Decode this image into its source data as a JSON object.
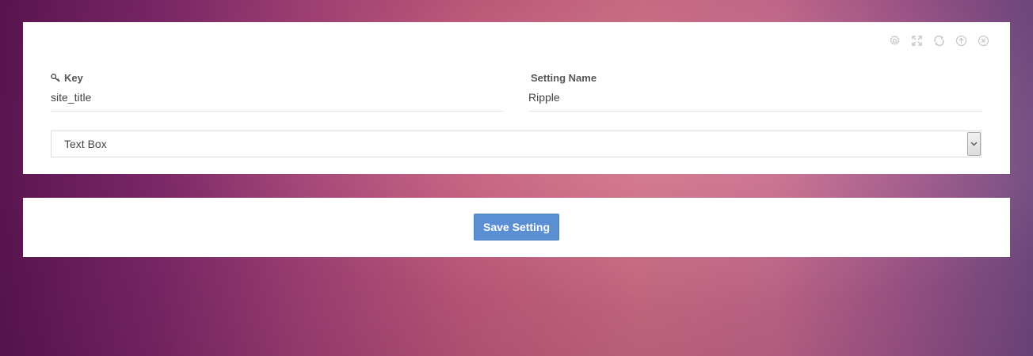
{
  "colors": {
    "panel_bg": "#ffffff",
    "accent_button": "#5b8fd4",
    "toolbar_icon": "#c8c8c8",
    "label_text": "#555555"
  },
  "toolbar": {
    "icons": [
      "gear-icon",
      "expand-icon",
      "refresh-icon",
      "collapse-up-icon",
      "close-icon"
    ]
  },
  "form": {
    "key": {
      "label": "Key",
      "icon": "key-icon",
      "value": "site_title"
    },
    "setting_name": {
      "label": "Setting Name",
      "value": "Ripple"
    },
    "type_select": {
      "selected": "Text Box"
    }
  },
  "actions": {
    "save_label": "Save Setting"
  }
}
